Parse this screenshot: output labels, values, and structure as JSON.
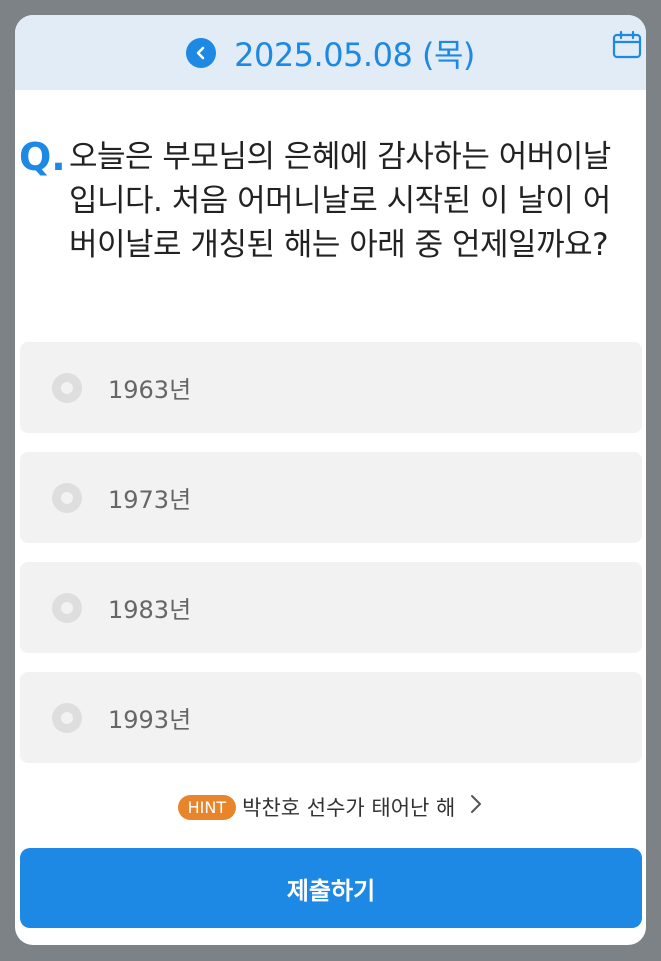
{
  "header": {
    "back_icon": "chevron-left-icon",
    "date": "2025.05.08 (목)",
    "calendar_icon": "calendar-icon"
  },
  "question": {
    "marker": "Q.",
    "text": "오늘은 부모님의 은혜에 감사하는 어버이날입니다. 처음 어머니날로 시작된 이 날이 어버이날로 개칭된 해는 아래 중 언제일까요?"
  },
  "options": [
    {
      "label": "1963년",
      "selected": false
    },
    {
      "label": "1973년",
      "selected": false
    },
    {
      "label": "1983년",
      "selected": false
    },
    {
      "label": "1993년",
      "selected": false
    }
  ],
  "hint": {
    "badge": "HINT",
    "text": "박찬호 선수가 태어난 해",
    "arrow": "chevron-right-icon"
  },
  "submit_label": "제출하기",
  "colors": {
    "accent": "#1e88e5",
    "hint_badge": "#e8842a",
    "option_bg": "#f2f2f2"
  }
}
